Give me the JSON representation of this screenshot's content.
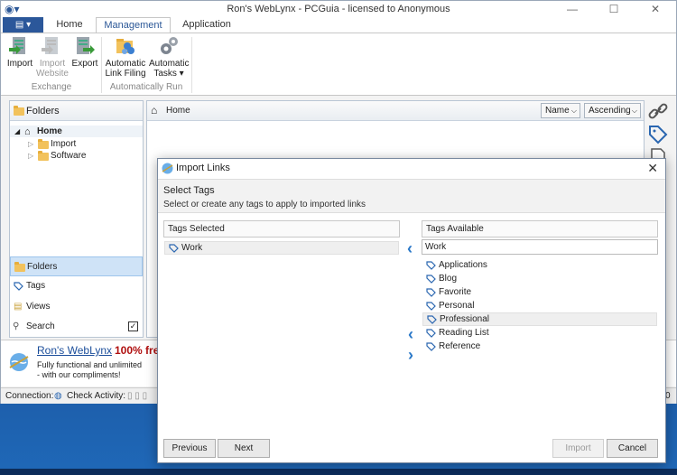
{
  "window": {
    "title": "Ron's WebLynx - PCGuia - licensed to Anonymous"
  },
  "ribbon": {
    "tabs": [
      {
        "label": "Home"
      },
      {
        "label": "Management"
      },
      {
        "label": "Application"
      }
    ],
    "groups": [
      {
        "label": "Exchange"
      },
      {
        "label": "Automatically Run"
      }
    ],
    "buttons": [
      {
        "label1": "Import",
        "label2": ""
      },
      {
        "label1": "Import",
        "label2": "Website"
      },
      {
        "label1": "Export",
        "label2": ""
      },
      {
        "label1": "Automatic",
        "label2": "Link Filing"
      },
      {
        "label1": "Automatic",
        "label2": "Tasks ▾"
      }
    ]
  },
  "left_panel": {
    "header": "Folders",
    "tree": [
      {
        "label": "Home"
      },
      {
        "label": "Import"
      },
      {
        "label": "Software"
      }
    ],
    "nav": [
      {
        "label": "Folders"
      },
      {
        "label": "Tags"
      },
      {
        "label": "Views"
      },
      {
        "label": "Search"
      }
    ]
  },
  "content": {
    "breadcrumb": "Home",
    "sort_field": "Name",
    "sort_order": "Ascending"
  },
  "promo": {
    "brand": "Ron's WebLynx",
    "headline": "100% fre",
    "line1": "Fully functional and unlimited",
    "line2": "- with our compliments!"
  },
  "status": {
    "connection": "Connection:",
    "check": "Check Activity:",
    "right": "0"
  },
  "dialog": {
    "title": "Import Links",
    "heading": "Select Tags",
    "description": "Select or create any tags to apply to imported links",
    "selected_header": "Tags Selected",
    "available_header": "Tags Available",
    "selected": [
      "Work"
    ],
    "input_value": "Work",
    "available": [
      "Applications",
      "Blog",
      "Favorite",
      "Personal",
      "Professional",
      "Reading List",
      "Reference"
    ],
    "buttons": {
      "previous": "Previous",
      "next": "Next",
      "import": "Import",
      "cancel": "Cancel"
    }
  }
}
